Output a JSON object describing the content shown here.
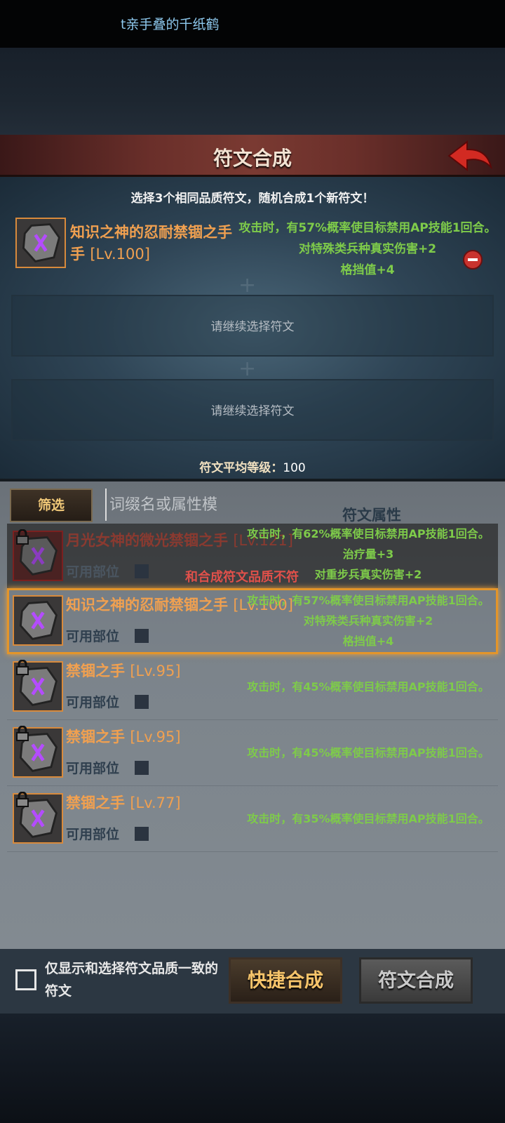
{
  "top": {
    "marquee": "t亲手叠的千纸鹤"
  },
  "header": {
    "title": "符文合成"
  },
  "synthesis": {
    "instruction": "选择3个相同品质符文，随机合成1个新符文！",
    "selected": {
      "name": "知识之神的忍耐禁锢之手",
      "level": "[Lv.100]",
      "attrs": [
        "攻击时，有57%概率使目标禁用AP技能1回合。",
        "对特殊类兵种真实伤害+2",
        "格挡值+4"
      ]
    },
    "empty_slot_text": "请继续选择符文",
    "avg_label": "符文平均等级：",
    "avg_value": "100"
  },
  "list_header": {
    "filter": "筛选",
    "search_placeholder": "词缀名或属性模",
    "attr_header": "符文属性"
  },
  "warning": "和合成符文品质不符",
  "runes": [
    {
      "name": "月光女神的微光禁锢之手",
      "level": "[Lv.121]",
      "sub": "可用部位",
      "attrs": [
        "攻击时，有62%概率使目标禁用AP技能1回合。",
        "治疗量+3",
        "对重步兵真实伤害+2"
      ]
    },
    {
      "name": "知识之神的忍耐禁锢之手",
      "level": "[Lv.100]",
      "sub": "可用部位",
      "attrs": [
        "攻击时，有57%概率使目标禁用AP技能1回合。",
        "对特殊类兵种真实伤害+2",
        "格挡值+4"
      ]
    },
    {
      "name": "禁锢之手",
      "level": "[Lv.95]",
      "sub": "可用部位",
      "attrs": [
        "攻击时，有45%概率使目标禁用AP技能1回合。"
      ]
    },
    {
      "name": "禁锢之手",
      "level": "[Lv.95]",
      "sub": "可用部位",
      "attrs": [
        "攻击时，有45%概率使目标禁用AP技能1回合。"
      ]
    },
    {
      "name": "禁锢之手",
      "level": "[Lv.77]",
      "sub": "可用部位",
      "attrs": [
        "攻击时，有35%概率使目标禁用AP技能1回合。"
      ]
    }
  ],
  "bottom": {
    "checkbox_label": "仅显示和选择符文品质一致的符文",
    "quick_button": "快捷合成",
    "synth_button": "符文合成"
  }
}
